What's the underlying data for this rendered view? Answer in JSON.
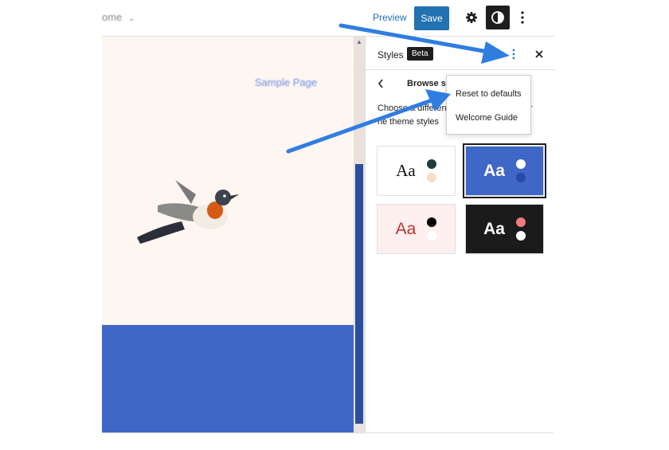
{
  "header": {
    "breadcrumb": "ome",
    "preview_label": "Preview",
    "save_label": "Save"
  },
  "canvas": {
    "site_link": "Sample Page"
  },
  "sidebar": {
    "title": "Styles",
    "badge": "Beta",
    "nav_title": "Browse st",
    "description_line1": "Choose a differen",
    "description_line1_end": "r",
    "description_line2": "he theme styles",
    "variations": [
      {
        "sample": "Aa",
        "text_color": "#111111",
        "bg": "#ffffff",
        "dot1": "#1f3d3b",
        "dot2": "#f9dcc6",
        "selected": false
      },
      {
        "sample": "Aa",
        "text_color": "#ffffff",
        "bg": "#3f67c7",
        "dot1": "#ffffff",
        "dot2": "#274aa8",
        "selected": true
      },
      {
        "sample": "Aa",
        "text_color": "#c0342f",
        "bg": "#fdf0ef",
        "dot1": "#000000",
        "dot2": "#ffffff",
        "selected": false
      },
      {
        "sample": "Aa",
        "text_color": "#ffffff",
        "bg": "#1b1b1b",
        "dot1": "#f07a80",
        "dot2": "#ffffff",
        "selected": false
      }
    ]
  },
  "menu": {
    "items": [
      "Reset to defaults",
      "Welcome Guide"
    ]
  },
  "colors": {
    "accent": "#2271b1",
    "annotation_arrow": "#2f7de1"
  },
  "icons": [
    "chevron-down-icon",
    "gear-icon",
    "contrast-icon",
    "more-vertical-icon",
    "close-icon",
    "chevron-left-icon"
  ]
}
